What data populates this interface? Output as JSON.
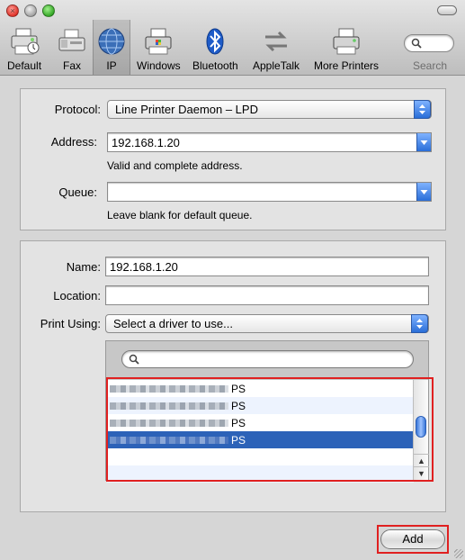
{
  "toolbar": {
    "items": [
      {
        "label": "Default",
        "icon": "default-printer-icon"
      },
      {
        "label": "Fax",
        "icon": "fax-icon"
      },
      {
        "label": "IP",
        "icon": "globe-icon"
      },
      {
        "label": "Windows",
        "icon": "windows-printer-icon"
      },
      {
        "label": "Bluetooth",
        "icon": "bluetooth-icon"
      },
      {
        "label": "AppleTalk",
        "icon": "appletalk-icon"
      },
      {
        "label": "More Printers",
        "icon": "more-printers-icon"
      }
    ],
    "selected": "IP",
    "search_label": "Search"
  },
  "connection": {
    "protocol_label": "Protocol:",
    "protocol_value": "Line Printer Daemon – LPD",
    "address_label": "Address:",
    "address_value": "192.168.1.20",
    "address_hint": "Valid and complete address.",
    "queue_label": "Queue:",
    "queue_value": "",
    "queue_hint": "Leave blank for default queue."
  },
  "printer": {
    "name_label": "Name:",
    "name_value": "192.168.1.20",
    "location_label": "Location:",
    "location_value": "",
    "print_using_label": "Print Using:",
    "print_using_value": "Select a driver to use..."
  },
  "driver_list": {
    "search_value": "",
    "rows": [
      {
        "suffix": "PS",
        "selected": false
      },
      {
        "suffix": "PS",
        "selected": false
      },
      {
        "suffix": "PS",
        "selected": false
      },
      {
        "suffix": "PS",
        "selected": true
      },
      {
        "suffix": "",
        "selected": false
      },
      {
        "suffix": "",
        "selected": false
      }
    ],
    "scroll_position": 0.45
  },
  "actions": {
    "add_label": "Add"
  },
  "colors": {
    "selection": "#2c62b8",
    "highlight": "#e02020",
    "accent_blue": "#2a6ed8"
  }
}
